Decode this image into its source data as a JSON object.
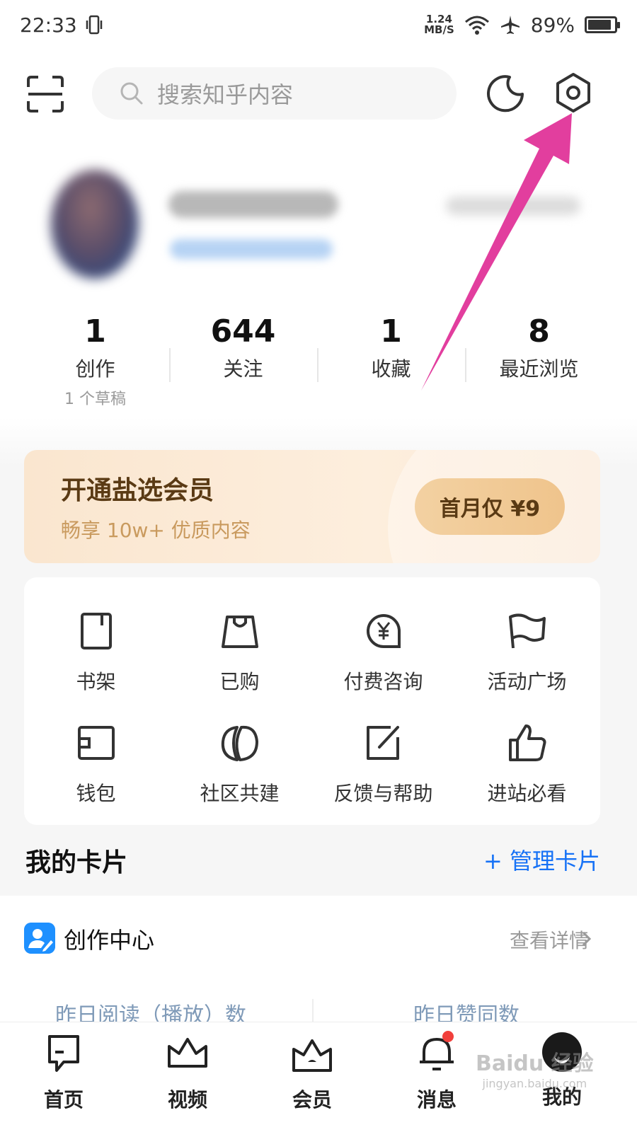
{
  "status_bar": {
    "time": "22:33",
    "net_speed_value": "1.24",
    "net_speed_unit": "MB/S",
    "battery": "89%",
    "battery_level": 0.89
  },
  "search": {
    "placeholder": "搜索知乎内容"
  },
  "stats": [
    {
      "value": "1",
      "label": "创作",
      "sub": "1 个草稿"
    },
    {
      "value": "644",
      "label": "关注"
    },
    {
      "value": "1",
      "label": "收藏"
    },
    {
      "value": "8",
      "label": "最近浏览"
    }
  ],
  "vip": {
    "title": "开通盐选会员",
    "subtitle": "畅享 10w+ 优质内容",
    "button": "首月仅 ¥9",
    "accent": "#efc48c"
  },
  "tools": [
    {
      "label": "书架",
      "icon": "bookshelf-icon"
    },
    {
      "label": "已购",
      "icon": "shopping-bag-icon"
    },
    {
      "label": "付费咨询",
      "icon": "paid-consult-icon"
    },
    {
      "label": "活动广场",
      "icon": "flag-icon"
    },
    {
      "label": "钱包",
      "icon": "wallet-icon"
    },
    {
      "label": "社区共建",
      "icon": "community-icon"
    },
    {
      "label": "反馈与帮助",
      "icon": "feedback-icon"
    },
    {
      "label": "进站必看",
      "icon": "thumbs-up-icon"
    }
  ],
  "cards": {
    "title": "我的卡片",
    "manage": "+ 管理卡片",
    "creator": {
      "title": "创作中心",
      "link": "查看详情",
      "metric_1": "昨日阅读（播放）数",
      "metric_2": "昨日赞同数"
    }
  },
  "bottom_nav": [
    {
      "label": "首页",
      "icon": "home-icon"
    },
    {
      "label": "视频",
      "icon": "video-crown-icon"
    },
    {
      "label": "会员",
      "icon": "member-crown-icon"
    },
    {
      "label": "消息",
      "icon": "bell-icon",
      "has_dot": true
    },
    {
      "label": "我的",
      "icon": "me-avatar-icon"
    }
  ],
  "watermark": {
    "main": "Baidu 经验",
    "sub": "jingyan.baidu.com"
  },
  "colors": {
    "accent_blue": "#1772f6",
    "annotation_arrow": "#e23e9e",
    "notification_dot": "#f1403c"
  }
}
